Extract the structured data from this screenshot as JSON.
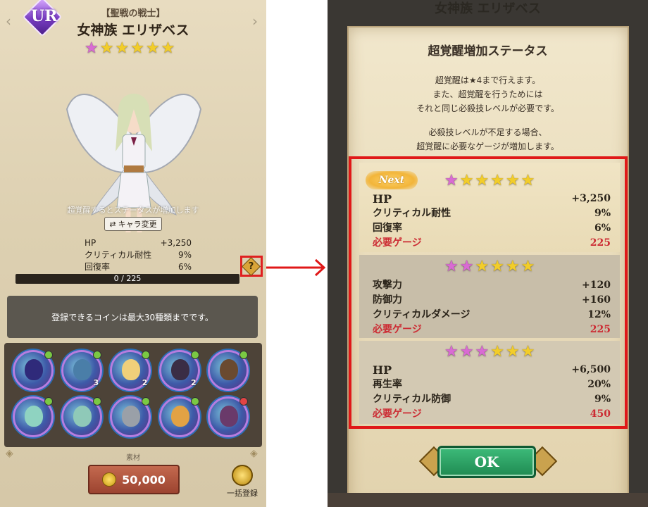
{
  "left": {
    "rarity": "UR",
    "title_sub": "【聖戦の戦士】",
    "title_main": "女神族 エリザベス",
    "awakening_hint": "超覚醒するとステータスが増加します",
    "chara_change": "キャラ変更",
    "stats": [
      {
        "label": "HP",
        "value": "+3,250"
      },
      {
        "label": "クリティカル耐性",
        "value": "9%"
      },
      {
        "label": "回復率",
        "value": "6%"
      }
    ],
    "help_icon": "?",
    "progress_text": "0 / 225",
    "progress_fraction": 0,
    "notice": "登録できるコインは最大30種類までです。",
    "coins": [
      {
        "face_color": "#2f2a7a",
        "gem": "#7ac943",
        "count": ""
      },
      {
        "face_color": "#4a7ea8",
        "gem": "#7ac943",
        "count": "3"
      },
      {
        "face_color": "#f0d07a",
        "gem": "#7ac943",
        "count": "2"
      },
      {
        "face_color": "#3a2d45",
        "gem": "#7ac943",
        "count": "2"
      },
      {
        "face_color": "#6a4a30",
        "gem": "#7ac943",
        "count": ""
      },
      {
        "face_color": "#8fd3c1",
        "gem": "#7ac943",
        "count": ""
      },
      {
        "face_color": "#8fc9b8",
        "gem": "#7ac943",
        "count": ""
      },
      {
        "face_color": "#9aa0a8",
        "gem": "#7ac943",
        "count": ""
      },
      {
        "face_color": "#e2a244",
        "gem": "#7ac943",
        "count": ""
      },
      {
        "face_color": "#6a3a6a",
        "gem": "#e24444",
        "count": ""
      }
    ],
    "material_label": "素材",
    "cost": "50,000",
    "bulk_register": "一括登録"
  },
  "right": {
    "background_title": "女神族 エリザベス",
    "title": "超覚醒増加ステータス",
    "intro_lines": [
      "超覚醒は★4まで行えます。",
      "また、超覚醒を行うためには",
      "それと同じ必殺技レベルが必要です。",
      "",
      "必殺技レベルが不足する場合、",
      "超覚醒に必要なゲージが増加します。"
    ],
    "next_label": "Next",
    "levels": [
      {
        "pink_stars": 1,
        "total_stars": 6,
        "stats": [
          {
            "label": "HP",
            "value": "+3,250",
            "kind": "hp"
          },
          {
            "label": "クリティカル耐性",
            "value": "9%",
            "kind": "normal"
          },
          {
            "label": "回復率",
            "value": "6%",
            "kind": "normal"
          },
          {
            "label": "必要ゲージ",
            "value": "225",
            "kind": "gauge"
          }
        ]
      },
      {
        "pink_stars": 2,
        "total_stars": 6,
        "stats": [
          {
            "label": "攻撃力",
            "value": "+120",
            "kind": "normal"
          },
          {
            "label": "防御力",
            "value": "+160",
            "kind": "normal"
          },
          {
            "label": "クリティカルダメージ",
            "value": "12%",
            "kind": "normal"
          },
          {
            "label": "必要ゲージ",
            "value": "225",
            "kind": "gauge"
          }
        ]
      },
      {
        "pink_stars": 3,
        "total_stars": 6,
        "stats": [
          {
            "label": "HP",
            "value": "+6,500",
            "kind": "hp"
          },
          {
            "label": "再生率",
            "value": "20%",
            "kind": "normal"
          },
          {
            "label": "クリティカル防御",
            "value": "9%",
            "kind": "normal"
          },
          {
            "label": "必要ゲージ",
            "value": "450",
            "kind": "gauge"
          }
        ]
      }
    ],
    "ok_label": "OK"
  },
  "colors": {
    "highlight_red": "#e01818",
    "gauge_red": "#cc2b33",
    "star_gold": "#f2cd2a",
    "star_pink": "#d96bd3",
    "ok_green": "#2a9e62"
  }
}
